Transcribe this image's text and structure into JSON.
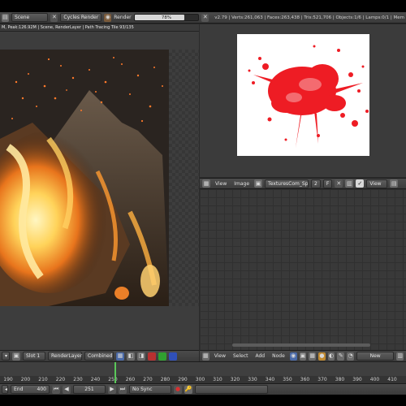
{
  "info_bar": {
    "scene_label": "Scene",
    "engine_label": "Cycles Render",
    "render_label": "Render",
    "progress_label": "78%",
    "progress_value": 0.78,
    "stats": "v2.79 | Verts:261,063 | Faces:263,438 | Tris:521,706 | Objects:1/6 | Lamps:0/1 | Mem"
  },
  "viewport": {
    "status_text": "M, Peak:126.92M | Scene, RenderLayer | Path Tracing Tile 93/135"
  },
  "image_editor": {
    "view_label": "View",
    "image_label": "Image",
    "texture_name": "TexturesCom_Splatt...",
    "texture_users": "2",
    "texture_f": "F",
    "view2_label": "View"
  },
  "bottom_left": {
    "slot_label": "Slot 1",
    "layer_label": "RenderLayer",
    "pass_label": "Combined"
  },
  "node_editor": {
    "view_label": "View",
    "select_label": "Select",
    "add_label": "Add",
    "node_label": "Node",
    "new_label": "New"
  },
  "timeline": {
    "ticks": [
      "190",
      "200",
      "210",
      "220",
      "230",
      "240",
      "250",
      "260",
      "270",
      "280",
      "290",
      "300",
      "310",
      "320",
      "330",
      "340",
      "350",
      "360",
      "370",
      "380",
      "390",
      "400",
      "410"
    ],
    "current_frame": 251
  },
  "playback": {
    "end_label": "End",
    "end_value": "400",
    "current_frame_label": "251",
    "sync_label": "No Sync"
  }
}
